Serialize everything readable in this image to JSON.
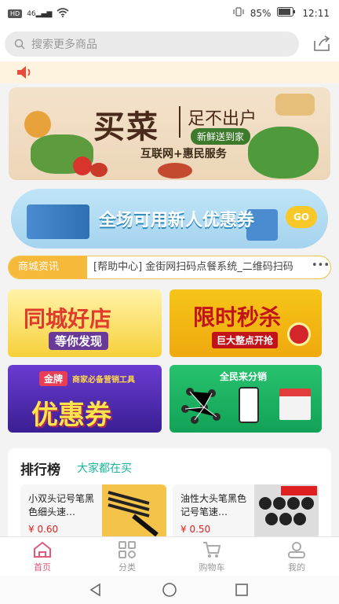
{
  "status_bar": {
    "signal": "46",
    "battery": "85%",
    "time": "12:11"
  },
  "search": {
    "placeholder": "搜索更多商品"
  },
  "banner": {
    "headline": "买菜",
    "slogan": "足不出户",
    "tag": "新鲜送到家",
    "subline": "互联网+惠民服务"
  },
  "coupon_banner": {
    "text": "全场可用新人优惠券",
    "badge": "GO"
  },
  "news": {
    "label": "商城资讯",
    "message": "[帮助中心] 金街网扫码点餐系统_二维码扫码"
  },
  "promos": {
    "good_shop": {
      "title": "同城好店",
      "subtitle": "等你发现"
    },
    "flash_sale": {
      "title": "限时秒杀",
      "subtitle": "巨大整点开抢"
    },
    "coupon": {
      "brand": "金牌",
      "subtitle": "商家必备营销工具",
      "title": "优惠券"
    },
    "distribution": {
      "title": "全民来分销"
    }
  },
  "ranking": {
    "title": "排行榜",
    "subtitle": "大家都在买",
    "products": [
      {
        "name": "小双头记号笔黑色细头速…",
        "price": "¥ 0.60"
      },
      {
        "name": "油性大头笔黑色记号笔速…",
        "price": "¥ 0.50"
      }
    ]
  },
  "tabs": [
    {
      "label": "首页",
      "active": true
    },
    {
      "label": "分类",
      "active": false
    },
    {
      "label": "购物车",
      "active": false
    },
    {
      "label": "我的",
      "active": false
    }
  ],
  "colors": {
    "accent": "#e0587a",
    "news_label": "#f6b93a",
    "ranking_sub": "#19b69a",
    "price": "#e02020"
  }
}
